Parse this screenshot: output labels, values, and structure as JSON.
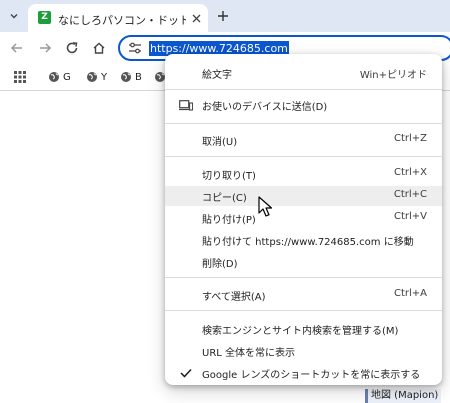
{
  "tab": {
    "title": "なにしろパソコン・ドットコム | マルチモ",
    "favicon_label": "Z"
  },
  "address_bar": {
    "url": "https://www.724685.com"
  },
  "bookmarks": [
    {
      "label": "G"
    },
    {
      "label": "Y"
    },
    {
      "label": "B"
    },
    {
      "label": ""
    }
  ],
  "page_peek": {
    "map_label": "地図 (Mapion)"
  },
  "context_menu": {
    "emoji": {
      "label": "絵文字",
      "shortcut": "Win+ピリオド"
    },
    "send_to_devices": {
      "label": "お使いのデバイスに送信(D)"
    },
    "undo": {
      "label": "取消(U)",
      "shortcut": "Ctrl+Z"
    },
    "cut": {
      "label": "切り取り(T)",
      "shortcut": "Ctrl+X"
    },
    "copy": {
      "label": "コピー(C)",
      "shortcut": "Ctrl+C"
    },
    "paste": {
      "label": "貼り付け(P)",
      "shortcut": "Ctrl+V"
    },
    "paste_go": {
      "label": "貼り付けて https://www.724685.com に移動"
    },
    "delete": {
      "label": "削除(D)"
    },
    "select_all": {
      "label": "すべて選択(A)",
      "shortcut": "Ctrl+A"
    },
    "manage_search": {
      "label": "検索エンジンとサイト内検索を管理する(M)"
    },
    "show_full_url": {
      "label": "URL 全体を常に表示"
    },
    "google_lens": {
      "label": "Google レンズのショートカットを常に表示する",
      "checked": true
    }
  },
  "colors": {
    "accent": "#0b57d0",
    "tabstrip": "#dfe7f5",
    "hover": "#eeeeee"
  }
}
